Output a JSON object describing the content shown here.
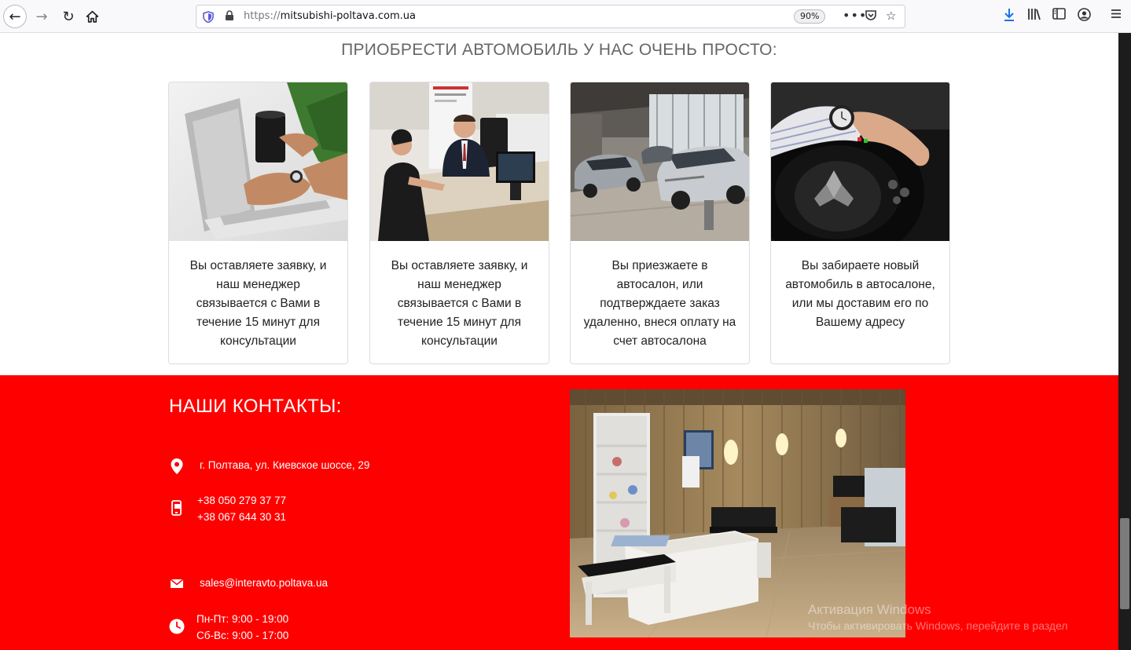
{
  "browser": {
    "url_scheme": "https://",
    "url_host": "mitsubishi-poltava.com.ua",
    "zoom": "90%"
  },
  "section": {
    "heading": "ПРИОБРЕСТИ АВТОМОБИЛЬ У НАС ОЧЕНЬ ПРОСТО:"
  },
  "cards": [
    {
      "text": "Вы оставляете заявку, и наш менеджер связывается с Вами в течение 15 минут для консультации"
    },
    {
      "text": "Вы оставляете заявку, и наш менеджер связывается с Вами в течение 15 минут для консультации"
    },
    {
      "text": "Вы приезжаете в автосалон, или подтверждаете заказ удаленно, внеся оплату на счет автосалона"
    },
    {
      "text": "Вы забираете новый автомобиль в автосалоне, или мы доставим его по Вашему адресу"
    }
  ],
  "contacts": {
    "title": "НАШИ КОНТАКТЫ:",
    "address": "г. Полтава, ул. Киевское шоссе, 29",
    "phone1": "+38 050 279 37 77",
    "phone2": "+38 067 644 30 31",
    "email": "sales@interavto.poltava.ua",
    "hours1": "Пн-Пт: 9:00 - 19:00",
    "hours2": "Сб-Вс: 9:00 - 17:00"
  },
  "watermark": {
    "line1": "Активация Windows",
    "line2": "Чтобы активировать Windows, перейдите в раздел"
  },
  "colors": {
    "contacts_bg": "#ff0000",
    "heading_text": "#666666"
  }
}
